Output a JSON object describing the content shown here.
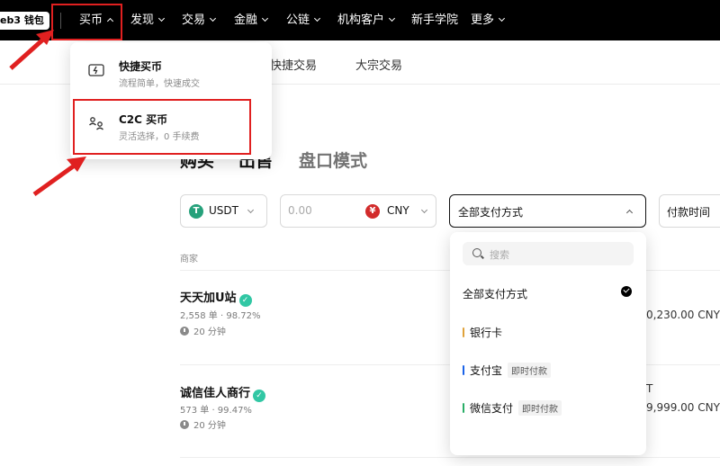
{
  "nav": {
    "wallet": "eb3 钱包",
    "items": [
      {
        "label": "买币",
        "chevron": "up"
      },
      {
        "label": "发现",
        "chevron": "down"
      },
      {
        "label": "交易",
        "chevron": "down"
      },
      {
        "label": "金融",
        "chevron": "down"
      },
      {
        "label": "公链",
        "chevron": "down"
      },
      {
        "label": "机构客户",
        "chevron": "down"
      },
      {
        "label": "新手学院",
        "chevron": "none"
      },
      {
        "label": "更多",
        "chevron": "down"
      }
    ]
  },
  "subtabs": [
    "快捷交易",
    "大宗交易"
  ],
  "buy_menu": [
    {
      "title": "快捷买币",
      "desc": "流程简单，快速成交",
      "icon": "card-lightning-icon"
    },
    {
      "title": "C2C 买币",
      "desc": "灵活选择，0 手续费",
      "icon": "people-exchange-icon"
    }
  ],
  "trade_tabs": {
    "buy": "购买",
    "sell": "出售",
    "orderbook": "盘口模式"
  },
  "filters": {
    "coin": "USDT",
    "amount_placeholder": "0.00",
    "fiat": "CNY",
    "payment": "全部支付方式",
    "sort": "付款时间"
  },
  "table": {
    "merchant_header": "商家"
  },
  "merchants": [
    {
      "name": "天天加U站",
      "stats": "2,558 单 · 98.72%",
      "time": "20 分钟",
      "amount": "0,230.00 CNY"
    },
    {
      "name": "诚信佳人商行",
      "stats": "573 单 · 99.47%",
      "time": "20 分钟",
      "amount_top": "T",
      "amount": "9,999.00 CNY"
    }
  ],
  "payment_menu": {
    "search_placeholder": "搜索",
    "options": [
      {
        "label": "全部支付方式",
        "color": "",
        "tag": "",
        "selected": true
      },
      {
        "label": "银行卡",
        "color": "#e0a23a",
        "tag": "",
        "selected": false
      },
      {
        "label": "支付宝",
        "color": "#1a62e8",
        "tag": "即时付款",
        "selected": false
      },
      {
        "label": "微信支付",
        "color": "#2aae67",
        "tag": "即时付款",
        "selected": false
      }
    ]
  },
  "colors": {
    "accent_red": "#e02020",
    "verified": "#31c7a4",
    "usdt": "#26a17b",
    "cny": "#d22b2b"
  }
}
